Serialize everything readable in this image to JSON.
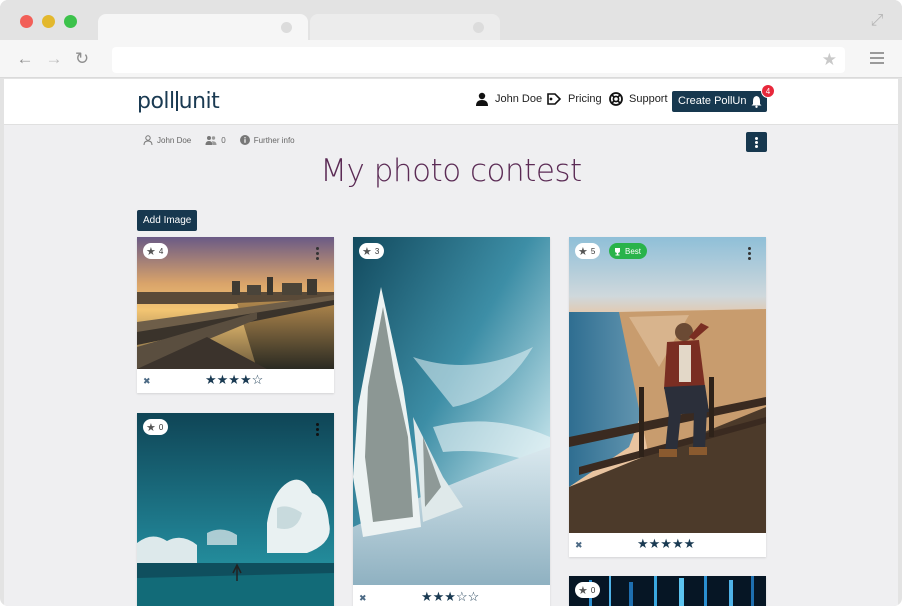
{
  "browser": {
    "url": ""
  },
  "header": {
    "logo_left": "poll",
    "logo_right": "unit",
    "nav": {
      "user": "John Doe",
      "pricing": "Pricing",
      "support": "Support"
    },
    "create_button": "Create PollUnit",
    "notification_count": "4"
  },
  "meta": {
    "owner": "John Doe",
    "participants": "0",
    "further_info": "Further info"
  },
  "title": "My photo contest",
  "add_image_button": "Add Image",
  "cards": [
    {
      "votes": "4",
      "rating": "★★★★☆",
      "best": ""
    },
    {
      "votes": "3",
      "rating": "★★★☆☆",
      "best": ""
    },
    {
      "votes": "5",
      "rating": "★★★★★",
      "best": "Best"
    },
    {
      "votes": "0",
      "rating": "",
      "best": ""
    },
    {
      "votes": "0",
      "rating": "",
      "best": ""
    }
  ],
  "colors": {
    "primary": "#17384f",
    "title": "#5b2b55",
    "badge": "#e8283b",
    "best": "#29b34a",
    "background": "#efeff1"
  }
}
